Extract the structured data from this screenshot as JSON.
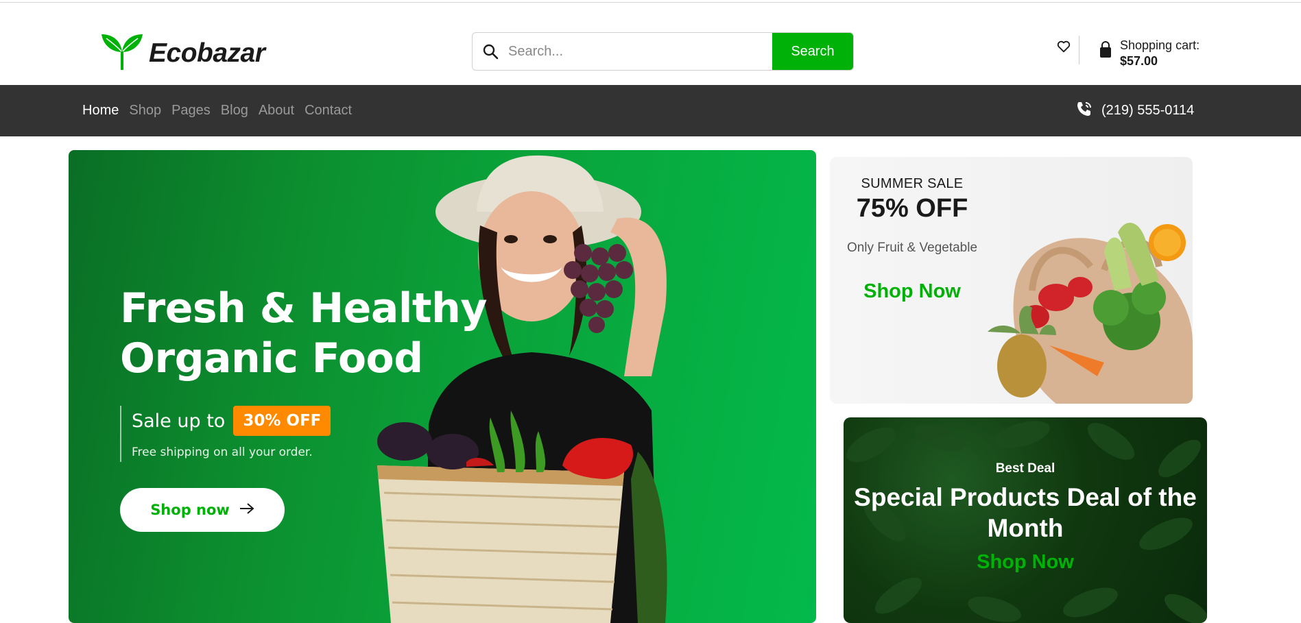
{
  "brand": {
    "name": "Ecobazar",
    "accent": "#00b207",
    "dark_bar": "#333333",
    "badge_color": "#ff8a00"
  },
  "search": {
    "placeholder": "Search...",
    "button_label": "Search"
  },
  "cart": {
    "label": "Shopping cart:",
    "total": "$57.00"
  },
  "icons": {
    "search": "search-icon",
    "wishlist": "heart-icon",
    "cart": "shopping-bag-icon",
    "phone": "phone-call-icon",
    "logo": "leaf-icon",
    "arrow": "arrow-right-icon"
  },
  "nav": {
    "items": [
      {
        "label": "Home",
        "active": true
      },
      {
        "label": "Shop"
      },
      {
        "label": "Pages"
      },
      {
        "label": "Blog"
      },
      {
        "label": "About"
      },
      {
        "label": "Contact"
      }
    ],
    "phone": "(219) 555-0114"
  },
  "hero": {
    "title_line1": "Fresh & Healthy",
    "title_line2": "Organic Food",
    "sale_label": "Sale up to",
    "sale_badge": "30% OFF",
    "shipping": "Free shipping on all your order.",
    "cta": "Shop now"
  },
  "summer_sale": {
    "kicker": "SUMMER SALE",
    "discount": "75% OFF",
    "subtitle": "Only Fruit & Vegetable",
    "cta": "Shop Now"
  },
  "best_deal": {
    "kicker": "Best Deal",
    "title": "Special Products Deal of the Month",
    "cta": "Shop Now"
  }
}
